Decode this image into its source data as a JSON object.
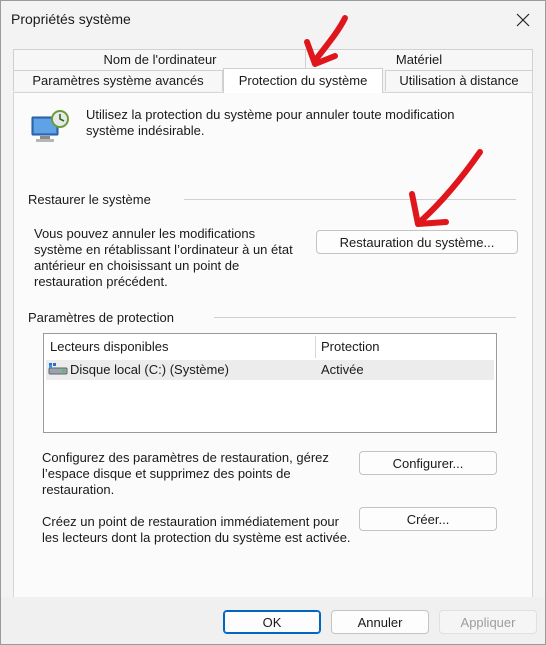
{
  "window": {
    "title": "Propriétés système"
  },
  "tabs": {
    "row_back": [
      {
        "label": "Nom de l'ordinateur"
      },
      {
        "label": "Matériel"
      }
    ],
    "row_front": [
      {
        "label": "Paramètres système avancés"
      },
      {
        "label": "Protection du système"
      },
      {
        "label": "Utilisation à distance"
      }
    ],
    "active": "Protection du système"
  },
  "intro": {
    "text": "Utilisez la protection du système pour annuler toute modification système indésirable."
  },
  "restore": {
    "heading": "Restaurer le système",
    "description": "Vous pouvez annuler les modifications système en rétablissant l’ordinateur à un état antérieur en choisissant un point de restauration précédent.",
    "button_label": "Restauration du système..."
  },
  "protection": {
    "heading": "Paramètres de protection",
    "columns": [
      "Lecteurs disponibles",
      "Protection"
    ],
    "drives": [
      {
        "name": "Disque local (C:) (Système)",
        "status": "Activée"
      }
    ],
    "configure_text": "Configurez des paramètres de restauration, gérez l’espace disque et supprimez des points de restauration.",
    "configure_button": "Configurer...",
    "create_text": "Créez un point de restauration immédiatement pour les lecteurs dont la protection du système est activée.",
    "create_button": "Créer..."
  },
  "footer": {
    "ok": "OK",
    "cancel": "Annuler",
    "apply": "Appliquer"
  },
  "colors": {
    "accent": "#0067c0",
    "annotation_arrow": "#e0161d"
  }
}
